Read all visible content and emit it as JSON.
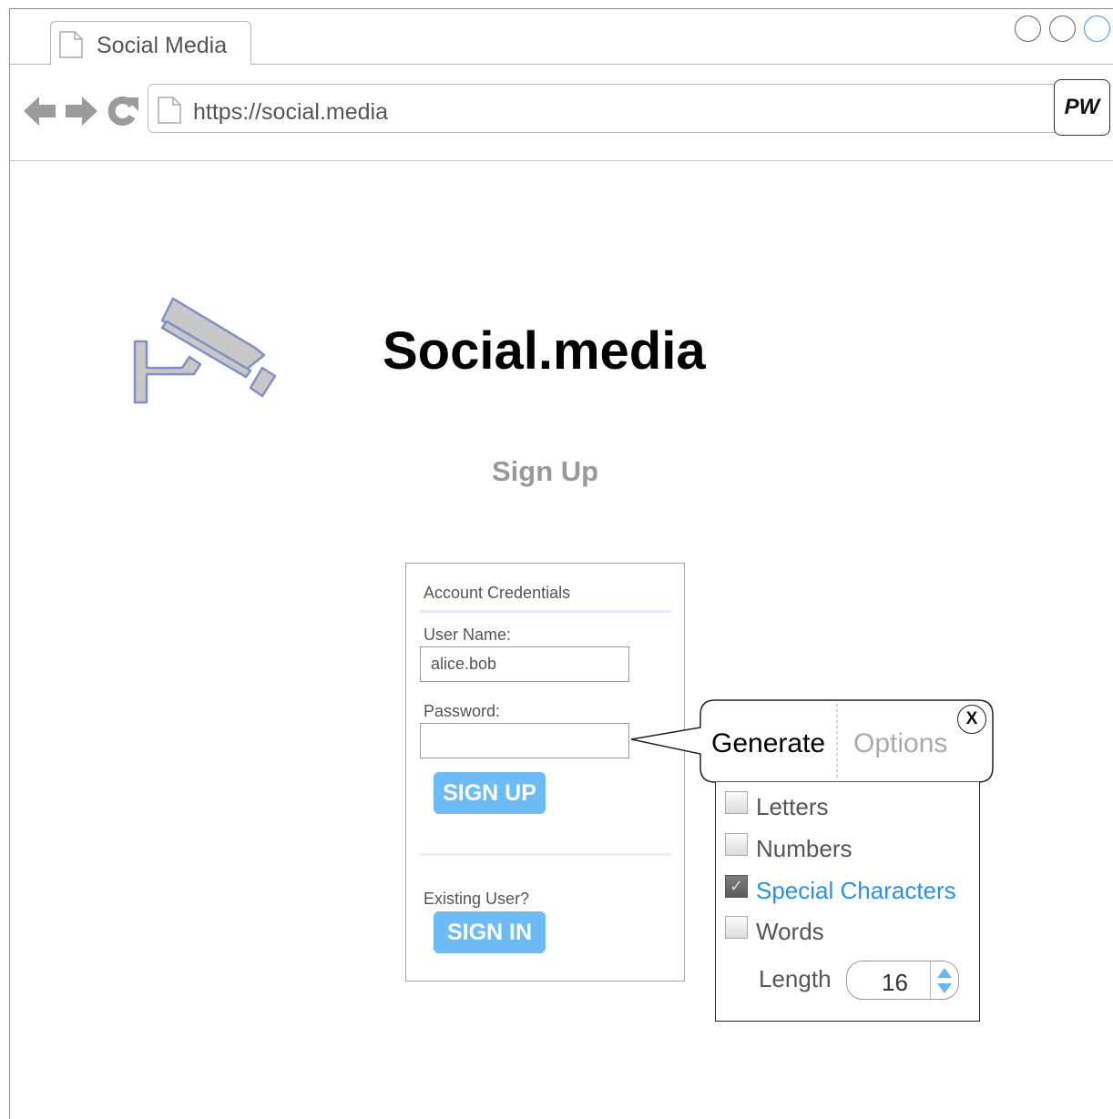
{
  "browser": {
    "tab_title": "Social Media",
    "url": "https://social.media",
    "extension_label": "PW"
  },
  "page": {
    "site_title": "Social.media",
    "heading": "Sign Up"
  },
  "form": {
    "section_title": "Account Credentials",
    "username_label": "User Name:",
    "username_value": "alice.bob",
    "password_label": "Password:",
    "password_value": "",
    "signup_label": "SIGN UP",
    "existing_user_label": "Existing User?",
    "signin_label": "SIGN IN"
  },
  "password_generator": {
    "tabs": [
      {
        "label": "Generate",
        "active": true
      },
      {
        "label": "Options",
        "active": false
      }
    ],
    "close_label": "X",
    "options": [
      {
        "label": "Letters",
        "checked": false
      },
      {
        "label": "Numbers",
        "checked": false
      },
      {
        "label": "Special Characters",
        "checked": true
      },
      {
        "label": "Words",
        "checked": false
      }
    ],
    "length_label": "Length",
    "length_value": "16"
  },
  "colors": {
    "primary_button": "#6dbbf4",
    "active_option": "#2b90e8",
    "camera_icon_fill": "#c8c8c8",
    "camera_icon_stroke": "#7f91c4"
  }
}
